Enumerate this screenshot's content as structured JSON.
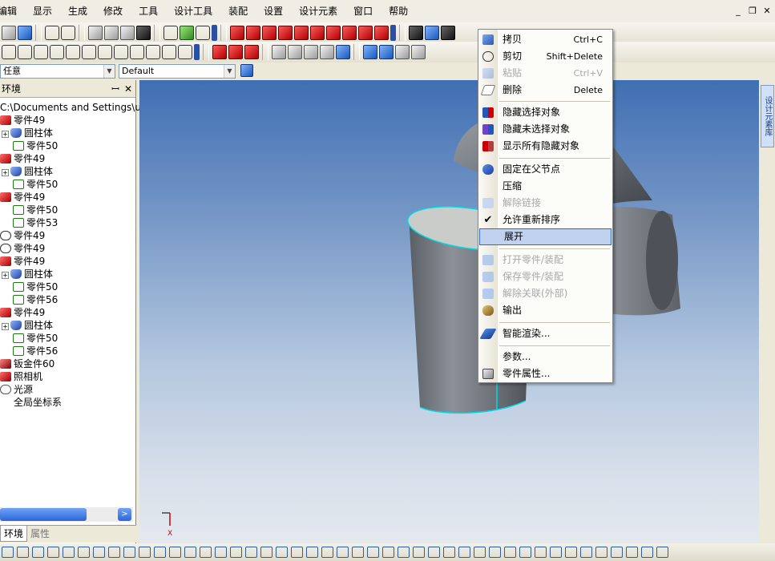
{
  "menubar": {
    "items": [
      "编辑",
      "显示",
      "生成",
      "修改",
      "工具",
      "设计工具",
      "装配",
      "设置",
      "设计元素",
      "窗口",
      "帮助"
    ]
  },
  "window_controls": {
    "minimize": "_",
    "restore": "❐",
    "close": "✕"
  },
  "combo_filter": {
    "value": "任意"
  },
  "combo_config": {
    "value": "Default"
  },
  "panel": {
    "title": "环境",
    "pin_icon": "ꟷ",
    "close_icon": "✕",
    "path": "C:\\Documents and Settings\\user\\桌",
    "tabs": [
      "环境",
      "属性"
    ]
  },
  "tree": {
    "rows": [
      {
        "label": "零件49",
        "icon": "part",
        "indent": 0,
        "expander": false
      },
      {
        "label": "圆柱体",
        "icon": "cyl",
        "indent": 1,
        "expander": true
      },
      {
        "label": "零件50",
        "icon": "grn",
        "indent": 2,
        "expander": false
      },
      {
        "label": "零件49",
        "icon": "part",
        "indent": 0,
        "expander": false
      },
      {
        "label": "圆柱体",
        "icon": "cyl",
        "indent": 1,
        "expander": true
      },
      {
        "label": "零件50",
        "icon": "grn",
        "indent": 2,
        "expander": false
      },
      {
        "label": "零件49",
        "icon": "part",
        "indent": 0,
        "expander": false
      },
      {
        "label": "零件50",
        "icon": "grn",
        "indent": 2,
        "expander": false
      },
      {
        "label": "零件53",
        "icon": "grn",
        "indent": 2,
        "expander": false
      },
      {
        "label": "零件49",
        "icon": "outl",
        "indent": 0,
        "expander": false
      },
      {
        "label": "零件49",
        "icon": "outl",
        "indent": 0,
        "expander": false
      },
      {
        "label": "零件49",
        "icon": "part",
        "indent": 0,
        "expander": false
      },
      {
        "label": "圆柱体",
        "icon": "cyl",
        "indent": 1,
        "expander": true
      },
      {
        "label": "零件50",
        "icon": "grn",
        "indent": 2,
        "expander": false
      },
      {
        "label": "零件56",
        "icon": "grn",
        "indent": 2,
        "expander": false
      },
      {
        "label": "零件49",
        "icon": "part",
        "indent": 0,
        "expander": false
      },
      {
        "label": "圆柱体",
        "icon": "cyl",
        "indent": 1,
        "expander": true
      },
      {
        "label": "零件50",
        "icon": "grn",
        "indent": 2,
        "expander": false
      },
      {
        "label": "零件56",
        "icon": "grn",
        "indent": 2,
        "expander": false
      },
      {
        "label": "钣金件60",
        "icon": "sheet",
        "indent": 0,
        "expander": false
      },
      {
        "label": "照相机",
        "icon": "cam",
        "indent": 0,
        "expander": false
      },
      {
        "label": "光源",
        "icon": "light",
        "indent": 0,
        "expander": false
      },
      {
        "label": "全局坐标系",
        "icon": "axis",
        "indent": 0,
        "expander": false
      }
    ]
  },
  "right_sidebar": {
    "design_tab": "设计元素库"
  },
  "context_menu": {
    "items": [
      {
        "label": "拷贝",
        "shortcut": "Ctrl+C",
        "icon": "copy",
        "disabled": false
      },
      {
        "label": "剪切",
        "shortcut": "Shift+Delete",
        "icon": "cut",
        "disabled": false
      },
      {
        "label": "粘贴",
        "shortcut": "Ctrl+V",
        "icon": "paste",
        "disabled": true
      },
      {
        "label": "删除",
        "shortcut": "Delete",
        "icon": "erase",
        "disabled": false
      },
      {
        "label": "隐藏选择对象",
        "shortcut": "",
        "icon": "hide",
        "disabled": false
      },
      {
        "label": "隐藏未选择对象",
        "shortcut": "",
        "icon": "hideun",
        "disabled": false
      },
      {
        "label": "显示所有隐藏对象",
        "shortcut": "",
        "icon": "showall",
        "disabled": false
      },
      {
        "label": "固定在父节点",
        "shortcut": "",
        "icon": "fix",
        "disabled": false
      },
      {
        "label": "压缩",
        "shortcut": "",
        "icon": "",
        "disabled": false
      },
      {
        "label": "解除链接",
        "shortcut": "",
        "icon": "unlink",
        "disabled": true
      },
      {
        "label": "允许重新排序",
        "shortcut": "",
        "icon": "check",
        "disabled": false
      },
      {
        "label": "展开",
        "shortcut": "",
        "icon": "",
        "disabled": false,
        "highlighted": true
      },
      {
        "label": "打开零件/装配",
        "shortcut": "",
        "icon": "open",
        "disabled": true
      },
      {
        "label": "保存零件/装配",
        "shortcut": "",
        "icon": "save",
        "disabled": true
      },
      {
        "label": "解除关联(外部)",
        "shortcut": "",
        "icon": "unrel",
        "disabled": true
      },
      {
        "label": "输出",
        "shortcut": "",
        "icon": "out",
        "disabled": false
      },
      {
        "label": "智能渲染...",
        "shortcut": "",
        "icon": "brush",
        "disabled": false
      },
      {
        "label": "参数...",
        "shortcut": "",
        "icon": "",
        "disabled": false
      },
      {
        "label": "零件属性...",
        "shortcut": "",
        "icon": "props",
        "disabled": false
      }
    ]
  },
  "axis_triad": {
    "x_label": "X"
  },
  "colors": {
    "selection_edge": "#00d8e6",
    "menu_highlight": "#c1d2ee",
    "scroll_thumb": "#2c66d9"
  }
}
